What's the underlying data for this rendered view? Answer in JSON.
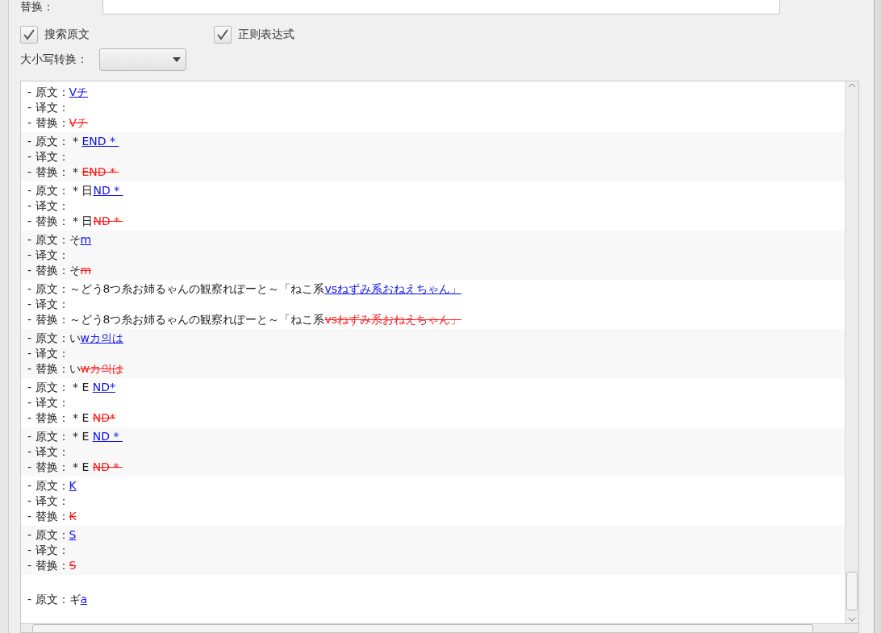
{
  "replace_field": {
    "label": "替换："
  },
  "options": [
    {
      "label": "搜索原文",
      "checked": true
    },
    {
      "label": "正则表达式",
      "checked": true
    }
  ],
  "case_convert": {
    "label": "大小写转换："
  },
  "entries": [
    {
      "lines": [
        {
          "kind": "original",
          "label": "- 原文：",
          "match": "Vチ"
        },
        {
          "kind": "translation",
          "label": "- 译文："
        },
        {
          "kind": "replace",
          "label": "- 替换：",
          "match": "Vチ"
        }
      ]
    },
    {
      "lines": [
        {
          "kind": "original",
          "label": "- 原文：",
          "prefix": " * ",
          "match": "END * "
        },
        {
          "kind": "translation",
          "label": "- 译文："
        },
        {
          "kind": "replace",
          "label": "- 替换：",
          "prefix": " * ",
          "match": "END * "
        }
      ]
    },
    {
      "lines": [
        {
          "kind": "original",
          "label": "- 原文：",
          "prefix": " * 日",
          "match": "ND * "
        },
        {
          "kind": "translation",
          "label": "- 译文："
        },
        {
          "kind": "replace",
          "label": "- 替换：",
          "prefix": " * 日",
          "match": "ND * "
        }
      ]
    },
    {
      "lines": [
        {
          "kind": "original",
          "label": "- 原文：",
          "prefix": "そ",
          "match": "m"
        },
        {
          "kind": "translation",
          "label": "- 译文："
        },
        {
          "kind": "replace",
          "label": "- 替换：",
          "prefix": "そ",
          "match": "m"
        }
      ]
    },
    {
      "lines": [
        {
          "kind": "original",
          "label": "- 原文：",
          "prefix": "～どう8つ糸お姉るゃんの観察れぽーと～「ねこ系",
          "match": "vsねずみ系おねえちゃん」"
        },
        {
          "kind": "translation",
          "label": "- 译文："
        },
        {
          "kind": "replace",
          "label": "- 替换：",
          "prefix": "～どう8つ糸お姉るゃんの観察れぽーと～「ねこ系",
          "match": "vsねずみ系おねえちゃん」"
        }
      ]
    },
    {
      "lines": [
        {
          "kind": "original",
          "label": "- 原文：",
          "prefix": "い",
          "match": "wカ의は"
        },
        {
          "kind": "translation",
          "label": "- 译文："
        },
        {
          "kind": "replace",
          "label": "- 替换：",
          "prefix": "い",
          "match": "wカ의は"
        }
      ]
    },
    {
      "lines": [
        {
          "kind": "original",
          "label": "- 原文：",
          "prefix": " * E ",
          "match": "ND*"
        },
        {
          "kind": "translation",
          "label": "- 译文："
        },
        {
          "kind": "replace",
          "label": "- 替换：",
          "prefix": " * E ",
          "match": "ND*"
        }
      ]
    },
    {
      "lines": [
        {
          "kind": "original",
          "label": "- 原文：",
          "prefix": " * E ",
          "match": "ND * "
        },
        {
          "kind": "translation",
          "label": "- 译文："
        },
        {
          "kind": "replace",
          "label": "- 替换：",
          "prefix": " * E ",
          "match": "ND * "
        }
      ]
    },
    {
      "lines": [
        {
          "kind": "original",
          "label": "- 原文：",
          "match": "K"
        },
        {
          "kind": "translation",
          "label": "- 译文："
        },
        {
          "kind": "replace",
          "label": "- 替换：",
          "match": "K"
        }
      ]
    },
    {
      "lines": [
        {
          "kind": "original",
          "label": "- 原文：",
          "match": "S"
        },
        {
          "kind": "translation",
          "label": "- 译文："
        },
        {
          "kind": "replace",
          "label": "- 替换：",
          "match": "S"
        }
      ]
    },
    {
      "lines": [
        {
          "kind": "original",
          "label": "- 原文：",
          "prefix": "ギ",
          "match": "a"
        }
      ]
    }
  ]
}
